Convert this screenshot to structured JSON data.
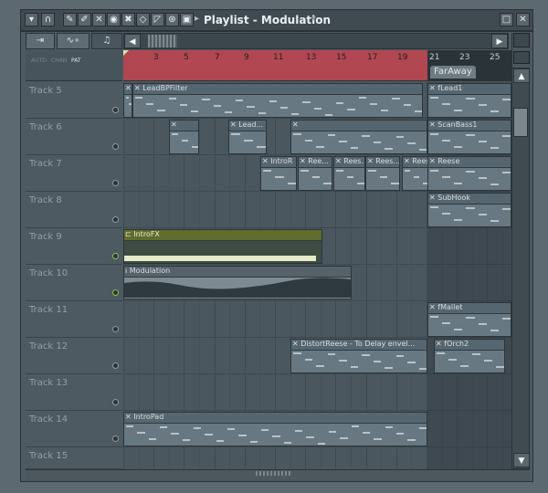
{
  "window": {
    "title": "Playlist - Modulation"
  },
  "mode_labels": [
    "AUTO",
    "CHAN",
    "PAT"
  ],
  "ruler": {
    "numbers": [
      "3",
      "5",
      "7",
      "9",
      "11",
      "13",
      "15",
      "17",
      "19",
      "21",
      "23",
      "25"
    ],
    "marker": "FarAway"
  },
  "tracks": [
    {
      "name": "Track 5"
    },
    {
      "name": "Track 6"
    },
    {
      "name": "Track 7"
    },
    {
      "name": "Track 8"
    },
    {
      "name": "Track 9"
    },
    {
      "name": "Track 10"
    },
    {
      "name": "Track 11"
    },
    {
      "name": "Track 12"
    },
    {
      "name": "Track 13"
    },
    {
      "name": "Track 14"
    },
    {
      "name": "Track 15"
    }
  ],
  "clips": [
    {
      "track": 0,
      "label": "Ii"
    },
    {
      "track": 0,
      "label": "LeadBPFilter"
    },
    {
      "track": 0,
      "label": "fLead1"
    },
    {
      "track": 1,
      "label": ""
    },
    {
      "track": 1,
      "label": "Lead..."
    },
    {
      "track": 1,
      "label": ""
    },
    {
      "track": 1,
      "label": "ScanBass1"
    },
    {
      "track": 2,
      "label": "IntroR"
    },
    {
      "track": 2,
      "label": "Ree..."
    },
    {
      "track": 2,
      "label": "Rees..."
    },
    {
      "track": 2,
      "label": "Rees..."
    },
    {
      "track": 2,
      "label": "Rees..."
    },
    {
      "track": 2,
      "label": "Reese"
    },
    {
      "track": 3,
      "label": "SubHook"
    },
    {
      "track": 4,
      "label": "IntroFX"
    },
    {
      "track": 5,
      "label": "Modulation"
    },
    {
      "track": 6,
      "label": "fMallet"
    },
    {
      "track": 7,
      "label": "DistortReese - To Delay envel..."
    },
    {
      "track": 7,
      "label": "fOrch2"
    },
    {
      "track": 9,
      "label": "IntroPad"
    }
  ]
}
